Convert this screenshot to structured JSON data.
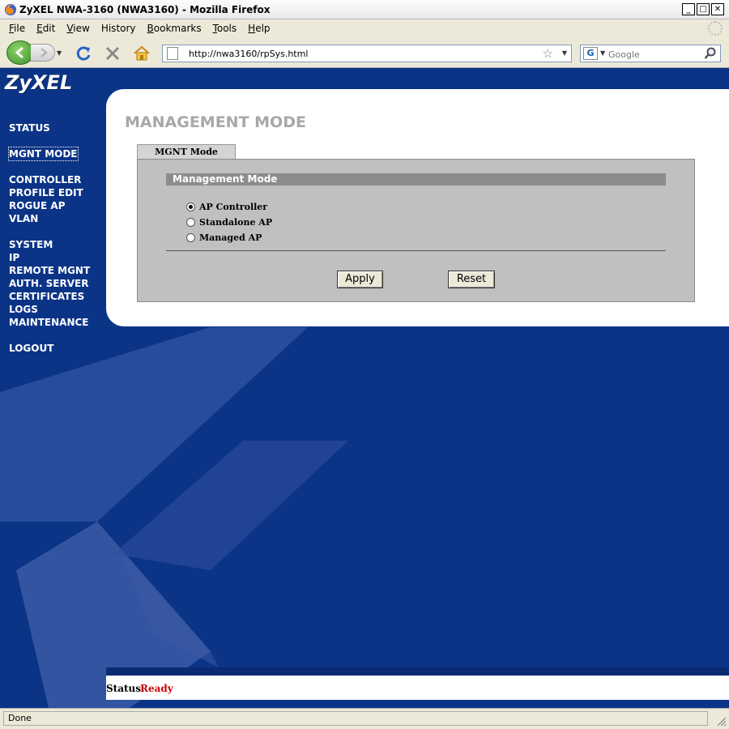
{
  "window": {
    "title": "ZyXEL NWA-3160 (NWA3160) - Mozilla Firefox",
    "minimize_label": "_",
    "maximize_label": "□",
    "close_label": "✕"
  },
  "menu": {
    "items": [
      {
        "first": "F",
        "rest": "ile"
      },
      {
        "first": "E",
        "rest": "dit"
      },
      {
        "first": "V",
        "rest": "iew"
      },
      {
        "first": "",
        "rest": "History",
        "ul_index": "s"
      },
      {
        "first": "B",
        "rest": "ookmarks"
      },
      {
        "first": "T",
        "rest": "ools"
      },
      {
        "first": "H",
        "rest": "elp"
      }
    ]
  },
  "navbar": {
    "url": "http://nwa3160/rpSys.html",
    "search_placeholder": "Google",
    "search_engine_icon": "G"
  },
  "app": {
    "logo": "ZyXEL",
    "nav": {
      "status": "STATUS",
      "mgnt_mode": "MGNT MODE",
      "controller": "CONTROLLER",
      "profile_edit": "PROFILE EDIT",
      "rogue_ap": "ROGUE AP",
      "vlan": "VLAN",
      "system": "SYSTEM",
      "ip": "IP",
      "remote_mgnt": "REMOTE MGNT",
      "auth_server": "AUTH. SERVER",
      "certificates": "CERTIFICATES",
      "logs": "LOGS",
      "maintenance": "MAINTENANCE",
      "logout": "LOGOUT"
    },
    "page_title": "MANAGEMENT MODE",
    "tab_label": "MGNT Mode",
    "section_title": "Management Mode",
    "options": [
      {
        "label": "AP Controller",
        "checked": true
      },
      {
        "label": "Standalone AP",
        "checked": false
      },
      {
        "label": "Managed AP",
        "checked": false
      }
    ],
    "apply_label": "Apply",
    "reset_label": "Reset",
    "status_label": "Status:",
    "status_value": "Ready"
  },
  "browser_status": "Done",
  "colors": {
    "content_bg": "#0b3487",
    "status_value": "#cc0000",
    "heading": "#a8a8a8"
  }
}
